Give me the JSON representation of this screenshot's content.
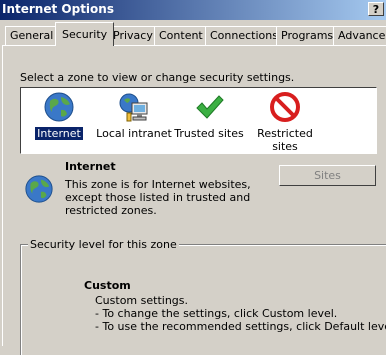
{
  "window": {
    "title": "Internet Options",
    "help_label": "?"
  },
  "tabs": [
    {
      "label": "General"
    },
    {
      "label": "Security"
    },
    {
      "label": "Privacy"
    },
    {
      "label": "Content"
    },
    {
      "label": "Connections"
    },
    {
      "label": "Programs"
    },
    {
      "label": "Advanced"
    }
  ],
  "security": {
    "prompt": "Select a zone to view or change security settings.",
    "zones": [
      {
        "label": "Internet",
        "icon": "globe-icon",
        "selected": true
      },
      {
        "label": "Local intranet",
        "icon": "intranet-icon"
      },
      {
        "label": "Trusted sites",
        "icon": "checkmark-icon"
      },
      {
        "label": "Restricted sites",
        "icon": "restricted-icon"
      }
    ],
    "selected_zone": {
      "name": "Internet",
      "description": "This zone is for Internet websites, except those listed in trusted and restricted zones."
    },
    "sites_button": "Sites",
    "level_group_title": "Security level for this zone",
    "level": {
      "name": "Custom",
      "lines": [
        "Custom settings.",
        "- To change the settings, click Custom level.",
        "- To use the recommended settings, click Default level."
      ]
    }
  },
  "colors": {
    "titlebar_start": "#0a246a",
    "titlebar_end": "#a6caf0",
    "face": "#d4d0c8",
    "selection": "#0a246a"
  }
}
